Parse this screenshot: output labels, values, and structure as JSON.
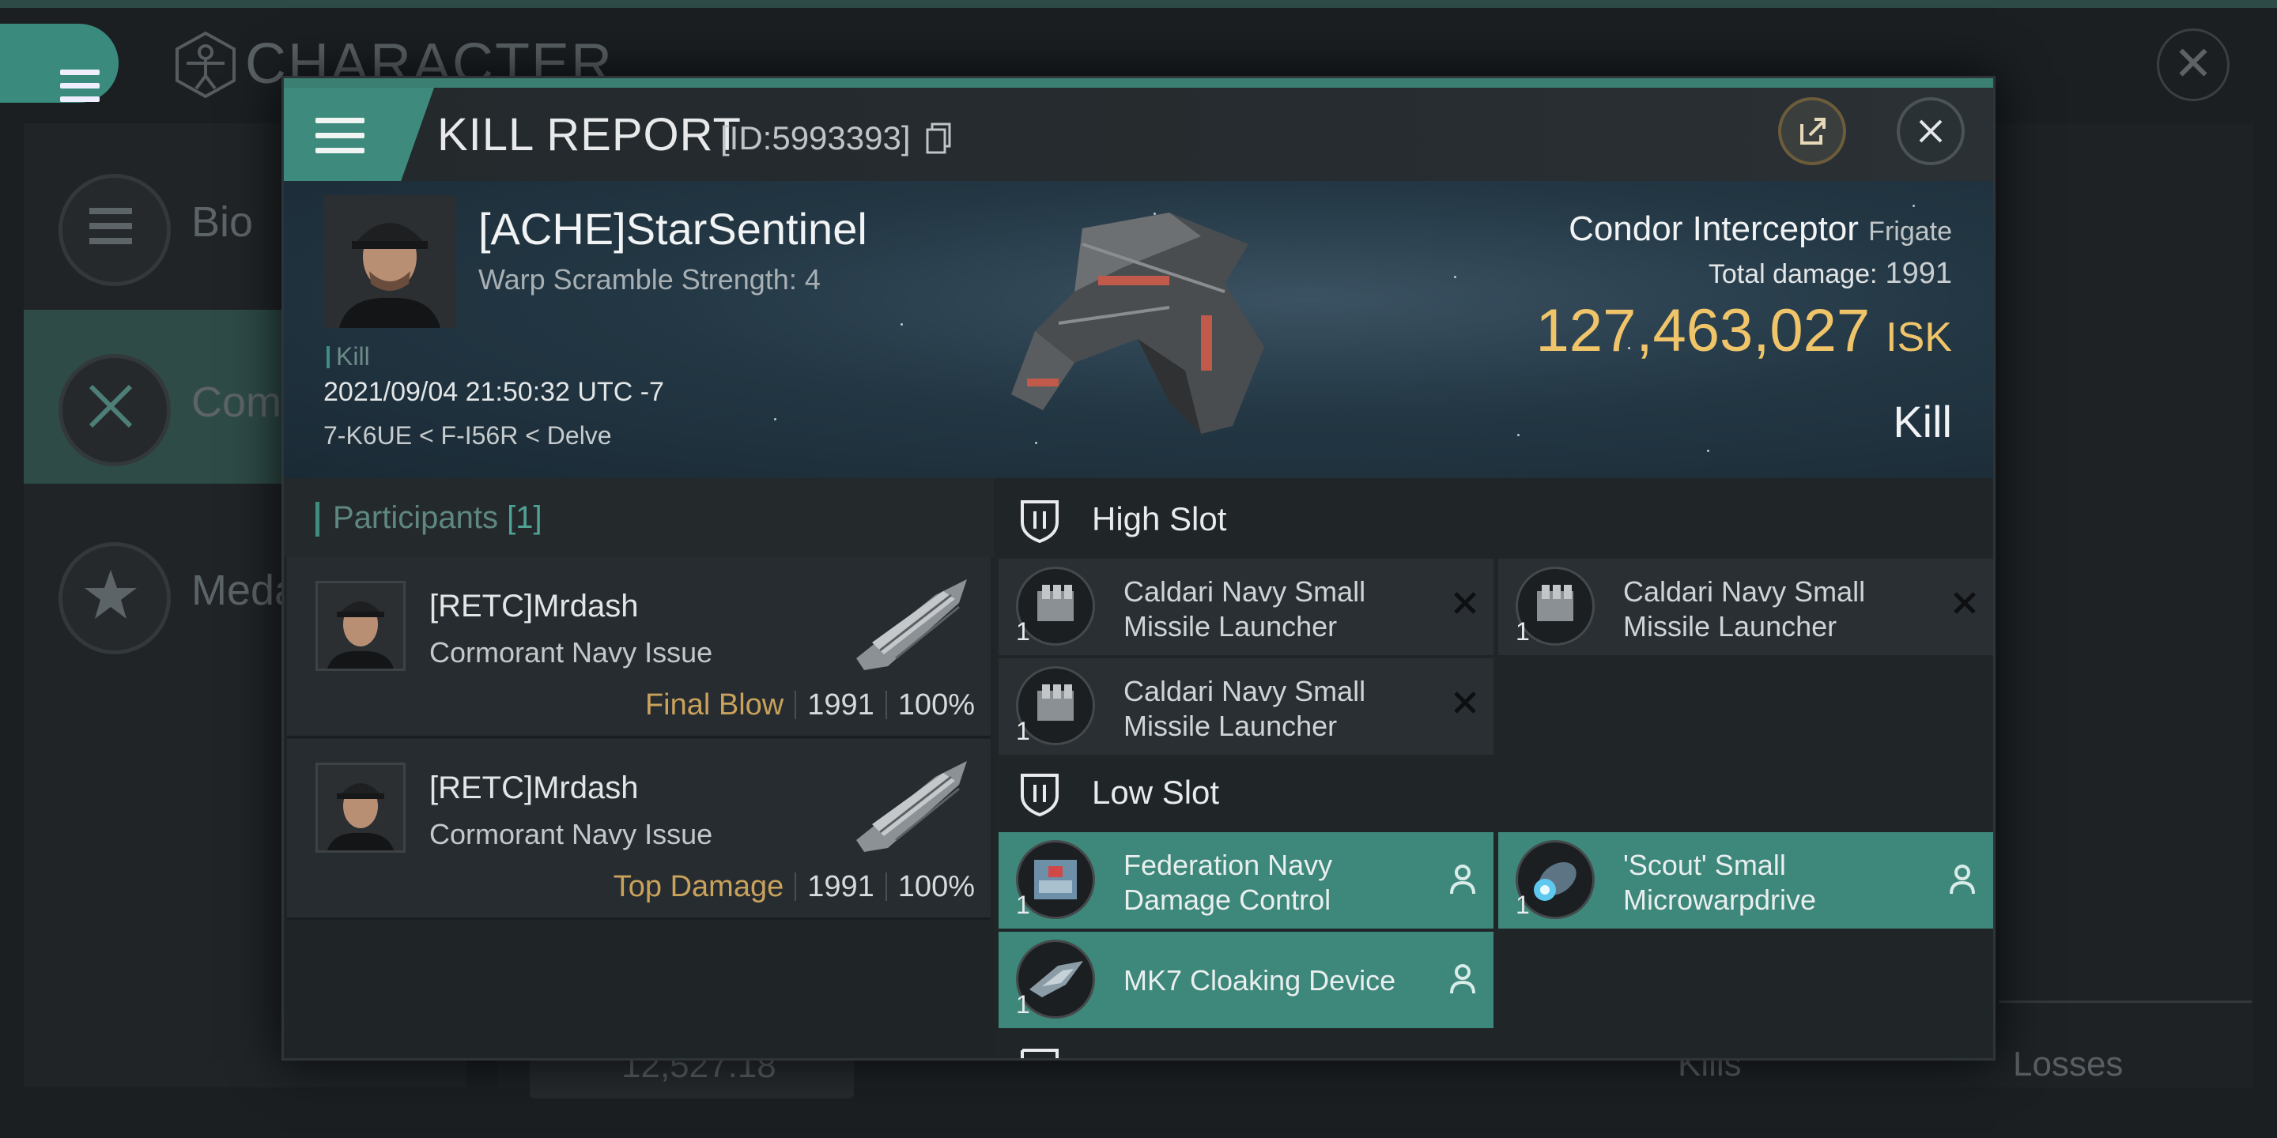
{
  "background": {
    "title": "CHARACTER",
    "sidebar": [
      {
        "label": "Bio"
      },
      {
        "label": "Com"
      },
      {
        "label": "Meda"
      }
    ],
    "wallet_value": "12,527.18",
    "kills_label": "Kills",
    "losses_label": "Losses"
  },
  "dialog": {
    "title": "KILL REPORT",
    "id_text": "[ID:5993393]",
    "victim": {
      "name": "[ACHE]StarSentinel",
      "warp_scramble": "Warp Scramble Strength: 4",
      "kill_tag": "Kill",
      "datetime": "2021/09/04 21:50:32 UTC -7",
      "location": "7-K6UE < F-I56R < Delve",
      "ship_name": "Condor Interceptor",
      "ship_class": "Frigate",
      "total_damage_label": "Total damage:",
      "total_damage_value": "1991",
      "isk_value": "127,463,027",
      "isk_unit": "ISK",
      "result": "Kill"
    },
    "participants": {
      "title": "Participants",
      "count": "[1]",
      "rows": [
        {
          "name": "[RETC]Mrdash",
          "ship": "Cormorant Navy Issue",
          "label": "Final Blow",
          "damage": "1991",
          "percent": "100%"
        },
        {
          "name": "[RETC]Mrdash",
          "ship": "Cormorant Navy Issue",
          "label": "Top Damage",
          "damage": "1991",
          "percent": "100%"
        }
      ]
    },
    "high_slot": {
      "title": "High Slot",
      "modules": [
        {
          "line1": "Caldari Navy Small",
          "line2": "Missile Launcher",
          "qty": "1"
        },
        {
          "line1": "Caldari Navy Small",
          "line2": "Missile Launcher",
          "qty": "1"
        },
        {
          "line1": "Caldari Navy Small",
          "line2": "Missile Launcher",
          "qty": "1"
        }
      ]
    },
    "low_slot": {
      "title": "Low Slot",
      "modules": [
        {
          "line1": "Federation Navy",
          "line2": "Damage Control",
          "qty": "1"
        },
        {
          "line1": "'Scout' Small",
          "line2": "Microwarpdrive",
          "qty": "1"
        },
        {
          "line1": "MK7 Cloaking Device",
          "line2": "",
          "qty": "1"
        }
      ]
    },
    "colors": {
      "accent": "#3e877b",
      "isk": "#f0c56a",
      "final_blow": "#c9a25c"
    }
  }
}
